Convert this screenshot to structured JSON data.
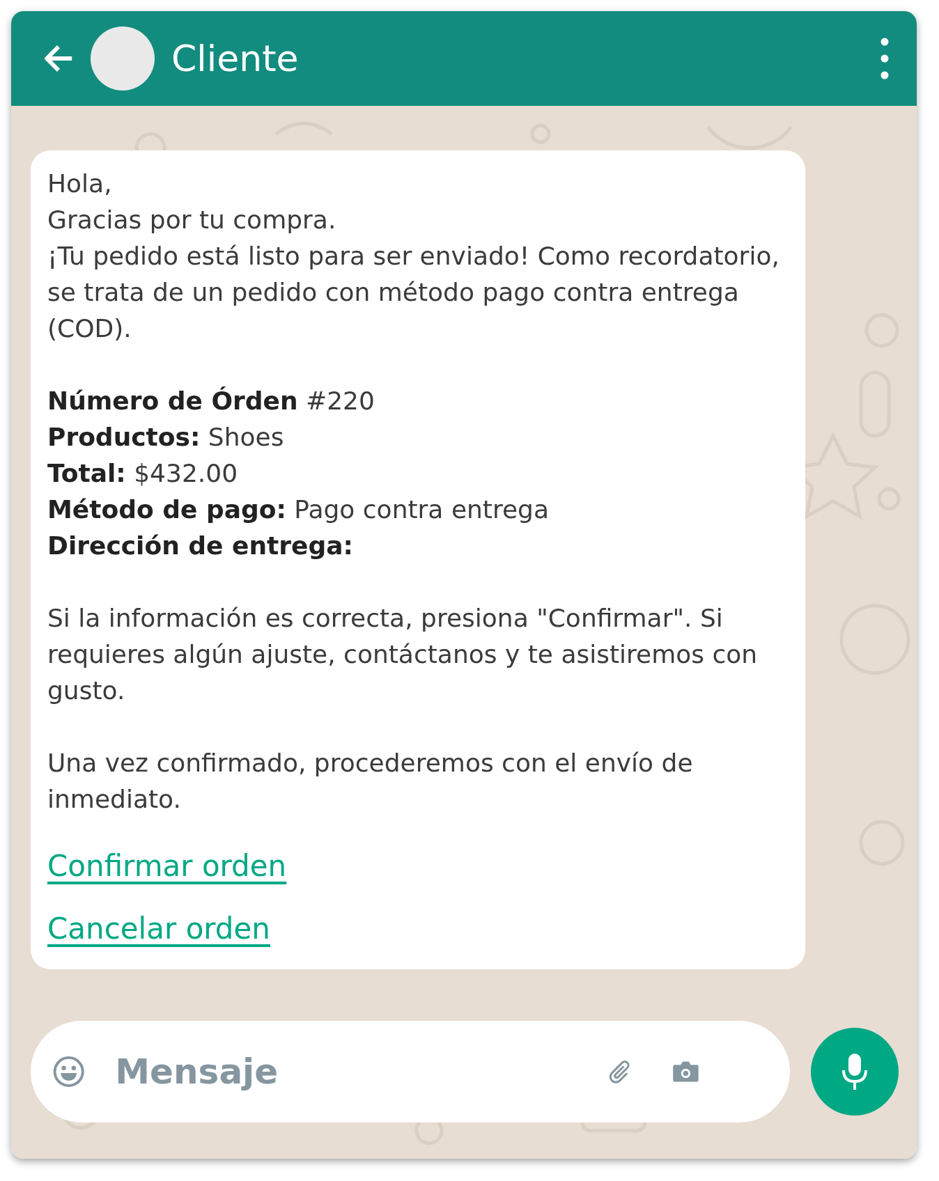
{
  "header": {
    "title": "Cliente"
  },
  "message": {
    "blocks": [
      {
        "lines": [
          "Hola,",
          "Gracias por tu compra.",
          "¡Tu pedido está listo para ser enviado! Como recordatorio, se trata de un pedido con método pago contra entrega (COD)."
        ]
      },
      {
        "lines": [
          "**Número de Órden** #220",
          "**Productos:** Shoes",
          "**Total:** $432.00",
          "**Método de pago:** Pago contra entrega",
          "**Dirección de entrega:**"
        ]
      },
      {
        "lines": [
          "Si la información es correcta, presiona \"Confirmar\". Si requieres algún ajuste, contáctanos y te asistiremos con gusto."
        ]
      },
      {
        "lines": [
          "Una vez confirmado, procederemos con el envío de inmediato."
        ]
      }
    ],
    "links": [
      "Confirmar orden",
      "Cancelar orden"
    ]
  },
  "composer": {
    "placeholder": "Mensaje"
  }
}
